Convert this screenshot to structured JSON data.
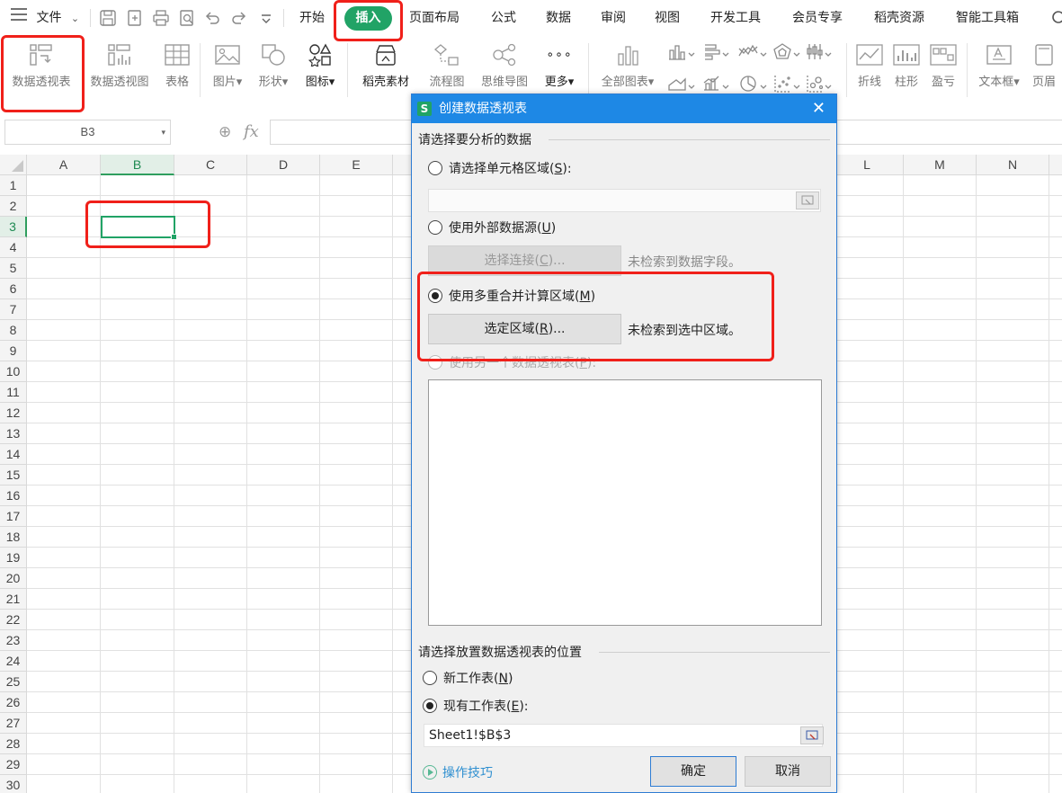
{
  "menubar": {
    "file_label": "文件",
    "tabs": [
      {
        "label": "开始"
      },
      {
        "label": "插入"
      },
      {
        "label": "页面布局"
      },
      {
        "label": "公式"
      },
      {
        "label": "数据"
      },
      {
        "label": "审阅"
      },
      {
        "label": "视图"
      },
      {
        "label": "开发工具"
      },
      {
        "label": "会员专享"
      },
      {
        "label": "稻壳资源"
      },
      {
        "label": "智能工具箱"
      }
    ],
    "active_tab": "插入"
  },
  "ribbon": {
    "items": [
      {
        "label": "数据透视表",
        "icon": "pivot-table-icon"
      },
      {
        "label": "数据透视图",
        "icon": "pivot-chart-icon"
      },
      {
        "label": "表格",
        "icon": "table-icon"
      },
      {
        "label": "图片",
        "icon": "picture-icon"
      },
      {
        "label": "形状",
        "icon": "shape-icon"
      },
      {
        "label": "图标",
        "icon": "icons-icon"
      },
      {
        "label": "稻壳素材",
        "icon": "docer-material-icon"
      },
      {
        "label": "流程图",
        "icon": "flowchart-icon"
      },
      {
        "label": "思维导图",
        "icon": "mindmap-icon"
      },
      {
        "label": "更多",
        "icon": "more-icon"
      },
      {
        "label": "全部图表",
        "icon": "all-charts-icon"
      },
      {
        "label": "折线",
        "icon": "sparkline-line-icon"
      },
      {
        "label": "柱形",
        "icon": "sparkline-column-icon"
      },
      {
        "label": "盈亏",
        "icon": "sparkline-winloss-icon"
      },
      {
        "label": "文本框",
        "icon": "textbox-icon"
      },
      {
        "label": "页眉",
        "icon": "header-icon"
      }
    ],
    "more_glyph": "∘∘∘"
  },
  "formula_bar": {
    "name_box": "B3",
    "fx_label": "fx"
  },
  "sheet": {
    "columns": [
      "A",
      "B",
      "C",
      "D",
      "E",
      "L",
      "M",
      "N"
    ],
    "rows": [
      "1",
      "2",
      "3",
      "4",
      "5",
      "6",
      "7",
      "8",
      "9",
      "10",
      "11",
      "12",
      "13",
      "14",
      "15",
      "16",
      "17",
      "18",
      "19",
      "20",
      "21",
      "22",
      "23",
      "24",
      "25",
      "26",
      "27",
      "28",
      "29",
      "30"
    ],
    "selected_column": "B",
    "selected_row": "3"
  },
  "dialog": {
    "logo_letter": "S",
    "title": "创建数据透视表",
    "section1_title": "请选择要分析的数据",
    "option_range": {
      "label": "请选择单元格区域(",
      "key": "S",
      "suffix": "):",
      "checked": false
    },
    "option_external": {
      "label": "使用外部数据源(",
      "key": "U",
      "suffix": ")",
      "checked": false
    },
    "select_connection_btn": {
      "label": "选择连接(",
      "key": "C",
      "suffix": ")..."
    },
    "external_hint": "未检索到数据字段。",
    "option_multi": {
      "label": "使用多重合并计算区域(",
      "key": "M",
      "suffix": ")",
      "checked": true
    },
    "select_range_btn": {
      "label": "选定区域(",
      "key": "R",
      "suffix": ")..."
    },
    "multi_hint": "未检索到选中区域。",
    "option_other_pivot": {
      "label": "使用另一个数据透视表(",
      "key": "P",
      "suffix": "):",
      "checked": false
    },
    "section2_title": "请选择放置数据透视表的位置",
    "option_new_sheet": {
      "label": "新工作表(",
      "key": "N",
      "suffix": ")",
      "checked": false
    },
    "option_existing_sheet": {
      "label": "现有工作表(",
      "key": "E",
      "suffix": "):",
      "checked": true
    },
    "location_value": "Sheet1!$B$3",
    "tips_label": "操作技巧",
    "ok_label": "确定",
    "cancel_label": "取消"
  },
  "colors": {
    "accent_green": "#21a366",
    "dialog_blue": "#1e88e5",
    "highlight_red": "#f0201a"
  }
}
